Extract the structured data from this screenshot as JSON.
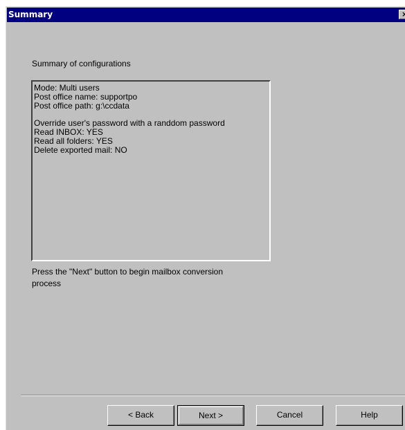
{
  "window": {
    "title": "Summary",
    "close_glyph": "×"
  },
  "heading": "Summary of configurations",
  "summary_lines": [
    "Mode: Multi users",
    "Post office name: supportpo",
    "Post office path: g:\\ccdata",
    "",
    "Override user's password with a randdom password",
    "Read INBOX: YES",
    "Read all folders: YES",
    "Delete exported mail: NO"
  ],
  "instruction": {
    "line1": "Press the \"Next\" button to begin mailbox conversion",
    "line2": "process"
  },
  "buttons": {
    "back": "< Back",
    "next": "Next >",
    "cancel": "Cancel",
    "help": "Help"
  }
}
